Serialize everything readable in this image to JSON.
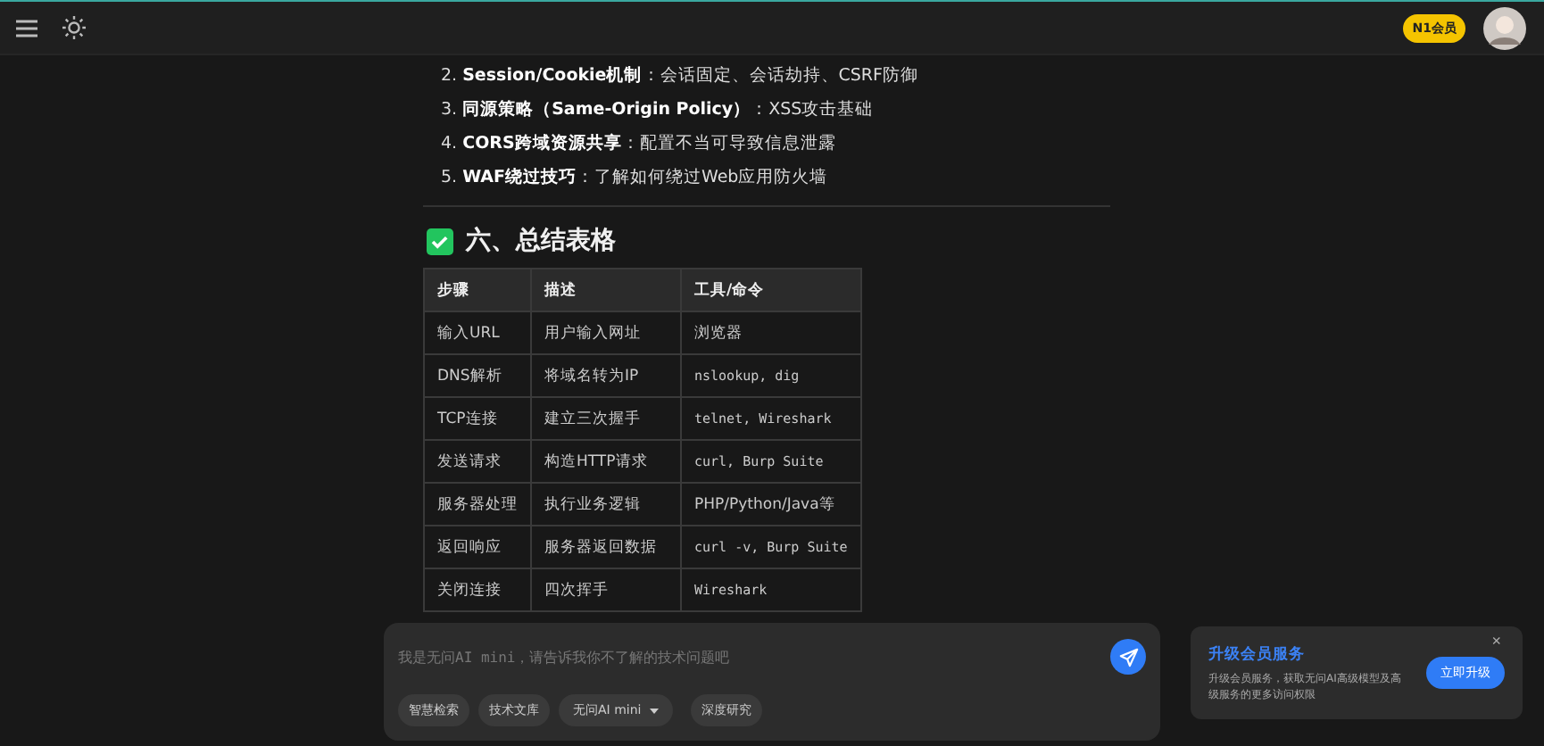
{
  "header": {
    "badge": "N1会员"
  },
  "list": [
    {
      "number": "2.",
      "term": "Session/Cookie机制",
      "text": "：会话固定、会话劫持、CSRF防御"
    },
    {
      "number": "3.",
      "term": "同源策略（Same-Origin Policy）",
      "text": "：XSS攻击基础"
    },
    {
      "number": "4.",
      "term": "CORS跨域资源共享",
      "text": "：配置不当可导致信息泄露"
    },
    {
      "number": "5.",
      "term": "WAF绕过技巧",
      "text": "：了解如何绕过Web应用防火墙"
    }
  ],
  "section": {
    "checked": true,
    "title": "六、总结表格"
  },
  "table": {
    "columns": [
      "步骤",
      "描述",
      "工具/命令"
    ],
    "rows": [
      {
        "cells": [
          "输入URL",
          "用户输入网址",
          "浏览器"
        ],
        "kind": "text"
      },
      {
        "cells": [
          "DNS解析",
          "将域名转为IP",
          "nslookup, dig"
        ],
        "kind": "code"
      },
      {
        "cells": [
          "TCP连接",
          "建立三次握手",
          "telnet, Wireshark"
        ],
        "kind": "code"
      },
      {
        "cells": [
          "发送请求",
          "构造HTTP请求",
          "curl, Burp Suite"
        ],
        "kind": "code"
      },
      {
        "cells": [
          "服务器处理",
          "执行业务逻辑",
          "PHP/Python/Java等"
        ],
        "kind": "text"
      },
      {
        "cells": [
          "返回响应",
          "服务器返回数据",
          "curl -v, Burp Suite"
        ],
        "kind": "code"
      },
      {
        "cells": [
          "关闭连接",
          "四次挥手",
          "Wireshark"
        ],
        "kind": "code"
      }
    ]
  },
  "composer": {
    "placeholder": "我是无问AI mini，请告诉我你不了解的技术问题吧",
    "chips": [
      {
        "label": "智慧检索",
        "kind": "toggle"
      },
      {
        "label": "技术文库",
        "kind": "toggle"
      },
      {
        "label": "无问AI mini",
        "kind": "dropdown"
      },
      {
        "label": "深度研究",
        "kind": "toggle"
      }
    ]
  },
  "promo": {
    "title": "升级会员服务",
    "text": "升级会员服务，获取无问AI高级模型及高级服务的更多访问权限",
    "button": "立即升级",
    "close": "×"
  }
}
